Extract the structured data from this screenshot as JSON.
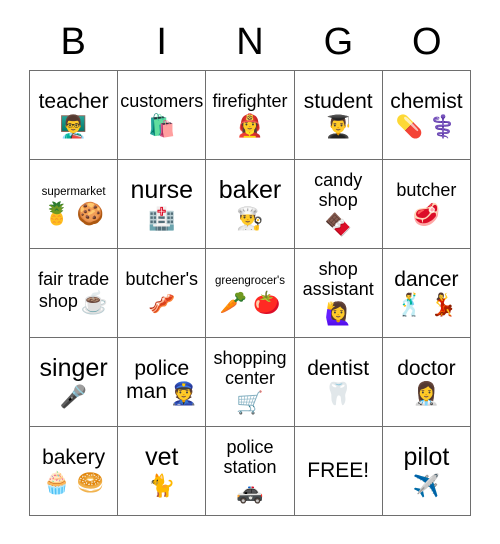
{
  "header": {
    "letters": [
      "B",
      "I",
      "N",
      "G",
      "O"
    ]
  },
  "grid": {
    "rows": 5,
    "columns": 5,
    "border_color": "#6e6e6e",
    "background_color": "#ffffff",
    "text_color": "#000000",
    "cells": [
      {
        "label": "teacher",
        "emoji": "👨‍🏫",
        "emoji_name": "man-teacher-emoji",
        "emoji_layout": "block",
        "size": "fs-lg"
      },
      {
        "label": "customers",
        "emoji": "🛍️",
        "emoji_name": "shopping-bags-emoji",
        "emoji_layout": "block",
        "size": "fs-md"
      },
      {
        "label": "firefighter",
        "emoji": "👩‍🚒",
        "emoji_name": "woman-firefighter-emoji",
        "emoji_layout": "block",
        "size": "fs-md"
      },
      {
        "label": "student",
        "emoji": "👨‍🎓",
        "emoji_name": "student-emoji",
        "emoji_layout": "block",
        "size": "fs-lg"
      },
      {
        "label": "chemist",
        "emoji": "💊 ⚕️",
        "emoji_name": "pill-and-medical-symbol-emoji",
        "emoji_layout": "block",
        "size": "fs-lg"
      },
      {
        "label": "supermarket",
        "emoji": "🍍 🍪",
        "emoji_name": "pineapple-and-cookie-emoji",
        "emoji_layout": "block",
        "size": "fs-xs"
      },
      {
        "label": "nurse",
        "emoji": "🏥",
        "emoji_name": "hospital-emoji",
        "emoji_layout": "block",
        "size": "fs-xl"
      },
      {
        "label": "baker",
        "emoji": "👨‍🍳",
        "emoji_name": "cook-emoji",
        "emoji_layout": "block",
        "size": "fs-xl"
      },
      {
        "label": "candy shop",
        "emoji": "🍫",
        "emoji_name": "chocolate-bar-emoji",
        "emoji_layout": "block",
        "size": "fs-md"
      },
      {
        "label": "butcher",
        "emoji": "🥩",
        "emoji_name": "cut-of-meat-emoji",
        "emoji_layout": "block",
        "size": "fs-md"
      },
      {
        "label": "fair trade shop",
        "emoji": "☕",
        "emoji_name": "hot-beverage-emoji",
        "emoji_layout": "inline",
        "size": "fs-md"
      },
      {
        "label": "butcher's",
        "emoji": "🥓",
        "emoji_name": "bacon-emoji",
        "emoji_layout": "block",
        "size": "fs-md"
      },
      {
        "label": "greengrocer's",
        "emoji": "🥕 🍅",
        "emoji_name": "carrot-and-tomato-emoji",
        "emoji_layout": "block",
        "size": "fs-xs"
      },
      {
        "label": "shop assistant",
        "emoji": "🙋‍♀️",
        "emoji_name": "woman-raising-hand-emoji",
        "emoji_layout": "block",
        "size": "fs-md"
      },
      {
        "label": "dancer",
        "emoji": "🕺 💃",
        "emoji_name": "man-dancing-and-woman-dancing-emoji",
        "emoji_layout": "block",
        "size": "fs-lg"
      },
      {
        "label": "singer",
        "emoji": "🎤",
        "emoji_name": "microphone-emoji",
        "emoji_layout": "block",
        "size": "fs-xl"
      },
      {
        "label": "police man",
        "emoji": "👮",
        "emoji_name": "police-officer-emoji",
        "emoji_layout": "inline",
        "size": "fs-lg"
      },
      {
        "label": "shopping center",
        "emoji": "🛒",
        "emoji_name": "shopping-cart-emoji",
        "emoji_layout": "block",
        "size": "fs-md"
      },
      {
        "label": "dentist",
        "emoji": "🦷",
        "emoji_name": "tooth-emoji",
        "emoji_layout": "block",
        "size": "fs-lg"
      },
      {
        "label": "doctor",
        "emoji": "👩‍⚕️",
        "emoji_name": "health-worker-emoji",
        "emoji_layout": "block",
        "size": "fs-lg"
      },
      {
        "label": "bakery",
        "emoji": "🧁 🥯",
        "emoji_name": "cupcake-and-bagel-emoji",
        "emoji_layout": "block",
        "size": "fs-lg"
      },
      {
        "label": "vet",
        "emoji": "🐈",
        "emoji_name": "cat-emoji",
        "emoji_layout": "block",
        "size": "fs-xl"
      },
      {
        "label": "police station",
        "emoji": "🚓",
        "emoji_name": "police-car-emoji",
        "emoji_layout": "block",
        "size": "fs-md"
      },
      {
        "label": "FREE!",
        "emoji": "",
        "emoji_name": "",
        "emoji_layout": "none",
        "size": "fs-lg"
      },
      {
        "label": "pilot",
        "emoji": "✈️",
        "emoji_name": "airplane-emoji",
        "emoji_layout": "block",
        "size": "fs-xl"
      }
    ]
  }
}
